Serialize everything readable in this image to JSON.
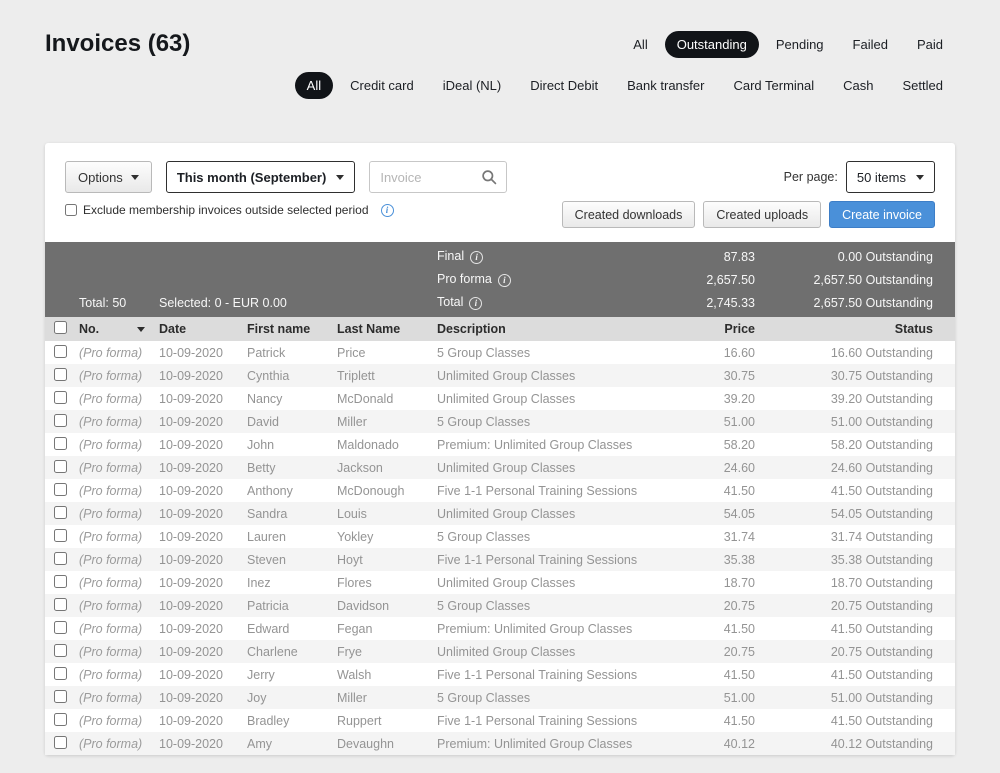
{
  "page": {
    "title": "Invoices",
    "count": "(63)"
  },
  "status_filters": [
    {
      "label": "All",
      "active": false
    },
    {
      "label": "Outstanding",
      "active": true
    },
    {
      "label": "Pending",
      "active": false
    },
    {
      "label": "Failed",
      "active": false
    },
    {
      "label": "Paid",
      "active": false
    }
  ],
  "payment_filters": [
    {
      "label": "All",
      "active": true
    },
    {
      "label": "Credit card",
      "active": false
    },
    {
      "label": "iDeal (NL)",
      "active": false
    },
    {
      "label": "Direct Debit",
      "active": false
    },
    {
      "label": "Bank transfer",
      "active": false
    },
    {
      "label": "Card Terminal",
      "active": false
    },
    {
      "label": "Cash",
      "active": false
    },
    {
      "label": "Settled",
      "active": false
    }
  ],
  "toolbar": {
    "options_label": "Options",
    "period_selected": "This month (September)",
    "search_placeholder": "Invoice",
    "exclude_label": "Exclude membership invoices outside selected period",
    "per_page_label": "Per page:",
    "per_page_value": "50 items",
    "created_downloads_label": "Created downloads",
    "created_uploads_label": "Created uploads",
    "create_invoice_label": "Create invoice"
  },
  "colors": {
    "accent_blue": "#4a90d9",
    "active_pill": "#111418",
    "summary_bar": "#6f6f6f"
  },
  "summary": {
    "total_label": "Total: 50",
    "selected_label": "Selected: 0 - EUR 0.00",
    "rows": [
      {
        "label": "Final",
        "amount": "87.83",
        "outstanding": "0.00 Outstanding"
      },
      {
        "label": "Pro forma",
        "amount": "2,657.50",
        "outstanding": "2,657.50 Outstanding"
      },
      {
        "label": "Total",
        "amount": "2,745.33",
        "outstanding": "2,657.50 Outstanding"
      }
    ]
  },
  "table": {
    "headers": {
      "no": "No.",
      "date": "Date",
      "first_name": "First name",
      "last_name": "Last Name",
      "description": "Description",
      "price": "Price",
      "status": "Status"
    },
    "rows": [
      {
        "no": "(Pro forma)",
        "date": "10-09-2020",
        "first": "Patrick",
        "last": "Price",
        "desc": "5 Group Classes",
        "price": "16.60",
        "status": "16.60 Outstanding"
      },
      {
        "no": "(Pro forma)",
        "date": "10-09-2020",
        "first": "Cynthia",
        "last": "Triplett",
        "desc": "Unlimited Group Classes",
        "price": "30.75",
        "status": "30.75 Outstanding"
      },
      {
        "no": "(Pro forma)",
        "date": "10-09-2020",
        "first": "Nancy",
        "last": "McDonald",
        "desc": "Unlimited Group Classes",
        "price": "39.20",
        "status": "39.20 Outstanding"
      },
      {
        "no": "(Pro forma)",
        "date": "10-09-2020",
        "first": "David",
        "last": "Miller",
        "desc": "5 Group Classes",
        "price": "51.00",
        "status": "51.00 Outstanding"
      },
      {
        "no": "(Pro forma)",
        "date": "10-09-2020",
        "first": "John",
        "last": "Maldonado",
        "desc": "Premium: Unlimited Group Classes",
        "price": "58.20",
        "status": "58.20 Outstanding"
      },
      {
        "no": "(Pro forma)",
        "date": "10-09-2020",
        "first": "Betty",
        "last": "Jackson",
        "desc": "Unlimited Group Classes",
        "price": "24.60",
        "status": "24.60 Outstanding"
      },
      {
        "no": "(Pro forma)",
        "date": "10-09-2020",
        "first": "Anthony",
        "last": "McDonough",
        "desc": "Five 1-1 Personal Training Sessions",
        "price": "41.50",
        "status": "41.50 Outstanding"
      },
      {
        "no": "(Pro forma)",
        "date": "10-09-2020",
        "first": "Sandra",
        "last": "Louis",
        "desc": "Unlimited Group Classes",
        "price": "54.05",
        "status": "54.05 Outstanding"
      },
      {
        "no": "(Pro forma)",
        "date": "10-09-2020",
        "first": "Lauren",
        "last": "Yokley",
        "desc": "5 Group Classes",
        "price": "31.74",
        "status": "31.74 Outstanding"
      },
      {
        "no": "(Pro forma)",
        "date": "10-09-2020",
        "first": "Steven",
        "last": "Hoyt",
        "desc": "Five 1-1 Personal Training Sessions",
        "price": "35.38",
        "status": "35.38 Outstanding"
      },
      {
        "no": "(Pro forma)",
        "date": "10-09-2020",
        "first": "Inez",
        "last": "Flores",
        "desc": "Unlimited Group Classes",
        "price": "18.70",
        "status": "18.70 Outstanding"
      },
      {
        "no": "(Pro forma)",
        "date": "10-09-2020",
        "first": "Patricia",
        "last": "Davidson",
        "desc": "5 Group Classes",
        "price": "20.75",
        "status": "20.75 Outstanding"
      },
      {
        "no": "(Pro forma)",
        "date": "10-09-2020",
        "first": "Edward",
        "last": "Fegan",
        "desc": "Premium: Unlimited Group Classes",
        "price": "41.50",
        "status": "41.50 Outstanding"
      },
      {
        "no": "(Pro forma)",
        "date": "10-09-2020",
        "first": "Charlene",
        "last": "Frye",
        "desc": "Unlimited Group Classes",
        "price": "20.75",
        "status": "20.75 Outstanding"
      },
      {
        "no": "(Pro forma)",
        "date": "10-09-2020",
        "first": "Jerry",
        "last": "Walsh",
        "desc": "Five 1-1 Personal Training Sessions",
        "price": "41.50",
        "status": "41.50 Outstanding"
      },
      {
        "no": "(Pro forma)",
        "date": "10-09-2020",
        "first": "Joy",
        "last": "Miller",
        "desc": "5 Group Classes",
        "price": "51.00",
        "status": "51.00 Outstanding"
      },
      {
        "no": "(Pro forma)",
        "date": "10-09-2020",
        "first": "Bradley",
        "last": "Ruppert",
        "desc": "Five 1-1 Personal Training Sessions",
        "price": "41.50",
        "status": "41.50 Outstanding"
      },
      {
        "no": "(Pro forma)",
        "date": "10-09-2020",
        "first": "Amy",
        "last": "Devaughn",
        "desc": "Premium: Unlimited Group Classes",
        "price": "40.12",
        "status": "40.12 Outstanding"
      }
    ]
  }
}
